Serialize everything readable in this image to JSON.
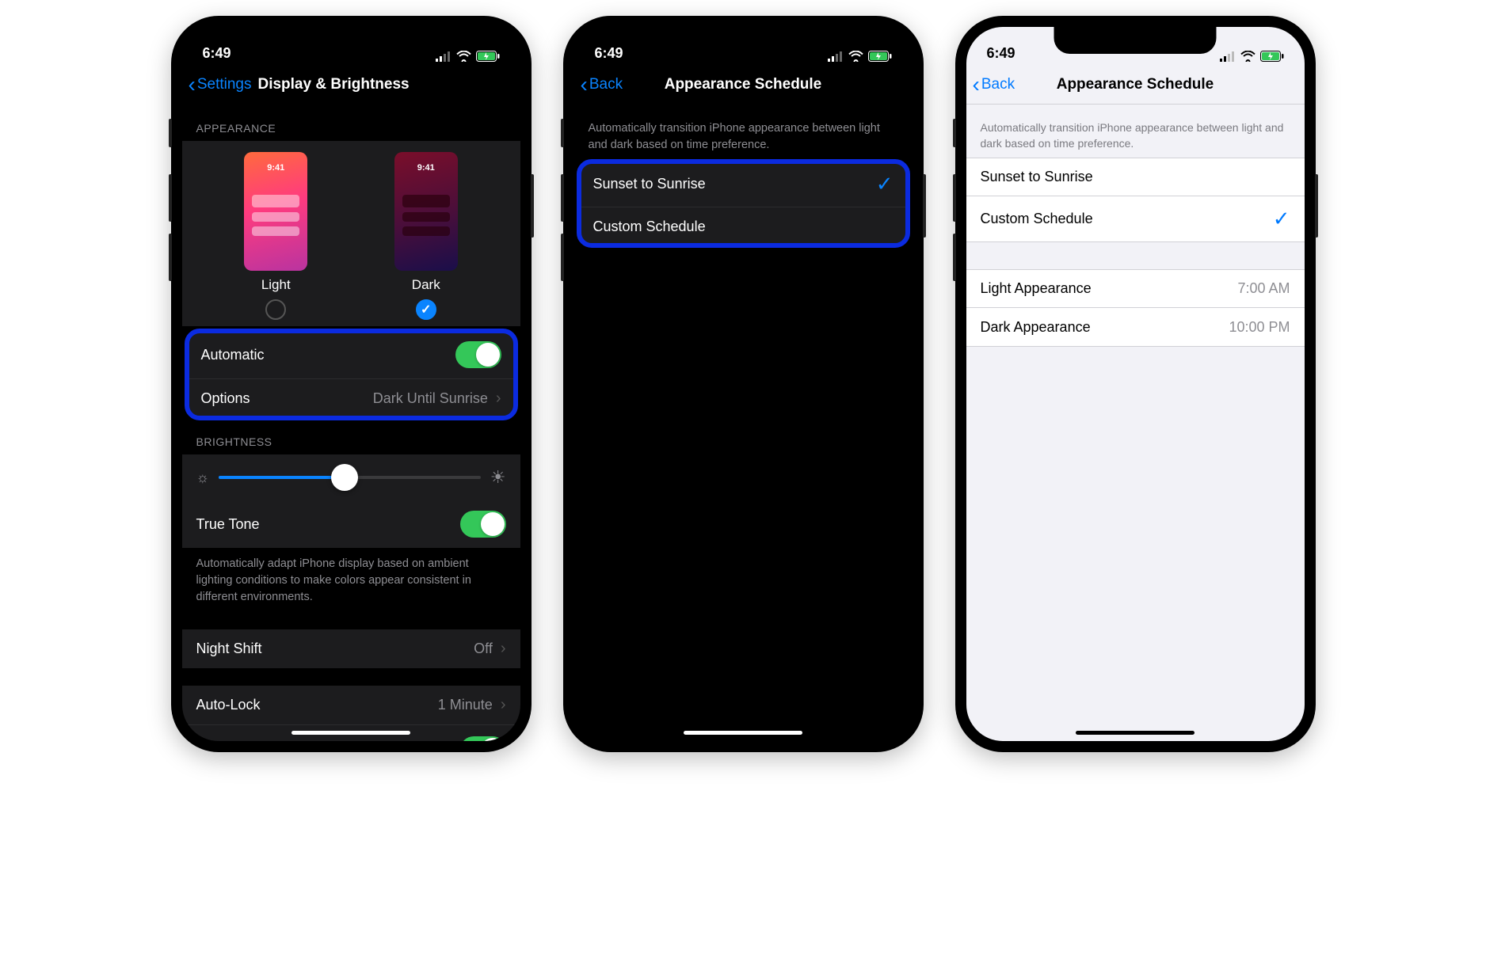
{
  "status": {
    "time": "6:49"
  },
  "phone1": {
    "back": "Settings",
    "title": "Display & Brightness",
    "appearance_header": "APPEARANCE",
    "thumb_time": "9:41",
    "light_label": "Light",
    "dark_label": "Dark",
    "automatic_label": "Automatic",
    "automatic_on": true,
    "options_label": "Options",
    "options_value": "Dark Until Sunrise",
    "brightness_header": "BRIGHTNESS",
    "brightness_percent": 48,
    "truetone_label": "True Tone",
    "truetone_on": true,
    "truetone_footer": "Automatically adapt iPhone display based on ambient lighting conditions to make colors appear consistent in different environments.",
    "nightshift_label": "Night Shift",
    "nightshift_value": "Off",
    "autolock_label": "Auto-Lock",
    "autolock_value": "1 Minute"
  },
  "phone2": {
    "back": "Back",
    "title": "Appearance Schedule",
    "header_footer": "Automatically transition iPhone appearance between light and dark based on time preference.",
    "opt1": "Sunset to Sunrise",
    "opt2": "Custom Schedule",
    "selected": "Sunset to Sunrise"
  },
  "phone3": {
    "back": "Back",
    "title": "Appearance Schedule",
    "header_footer": "Automatically transition iPhone appearance between light and dark based on time preference.",
    "opt1": "Sunset to Sunrise",
    "opt2": "Custom Schedule",
    "selected": "Custom Schedule",
    "light_row": "Light Appearance",
    "light_time": "7:00 AM",
    "dark_row": "Dark Appearance",
    "dark_time": "10:00 PM"
  }
}
